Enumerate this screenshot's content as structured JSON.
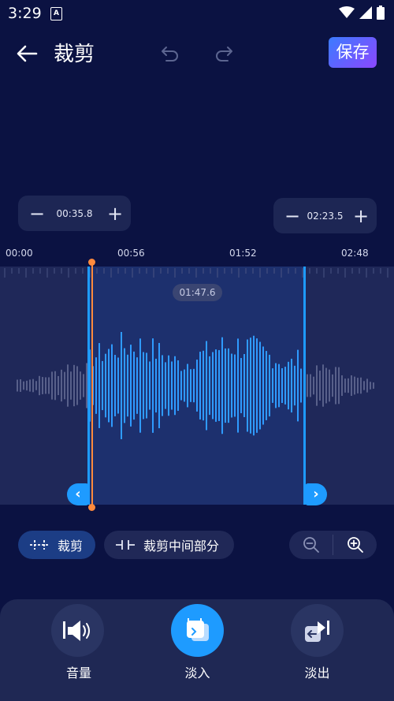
{
  "status_bar": {
    "time": "3:29",
    "notification_glyph": "A"
  },
  "header": {
    "title": "裁剪",
    "save_label": "保存"
  },
  "range": {
    "start": {
      "time": "00:35.8",
      "minus": "−",
      "plus": "+"
    },
    "end": {
      "time": "02:23.5",
      "minus": "−",
      "plus": "+"
    }
  },
  "timeline": {
    "ticks": [
      "00:00",
      "00:56",
      "01:52",
      "02:48"
    ]
  },
  "playhead": {
    "time": "01:47.6"
  },
  "modes": {
    "trim": "裁剪",
    "trim_middle": "裁剪中间部分"
  },
  "tools": [
    {
      "label": "音量",
      "icon": "volume-icon"
    },
    {
      "label": "淡入",
      "icon": "fade-in-icon"
    },
    {
      "label": "淡出",
      "icon": "fade-out-icon"
    }
  ],
  "colors": {
    "background": "#0b1242",
    "accent": "#1e9bff",
    "playhead": "#ff8a3d",
    "save_gradient_start": "#3b7bff",
    "save_gradient_end": "#8c47ff"
  }
}
